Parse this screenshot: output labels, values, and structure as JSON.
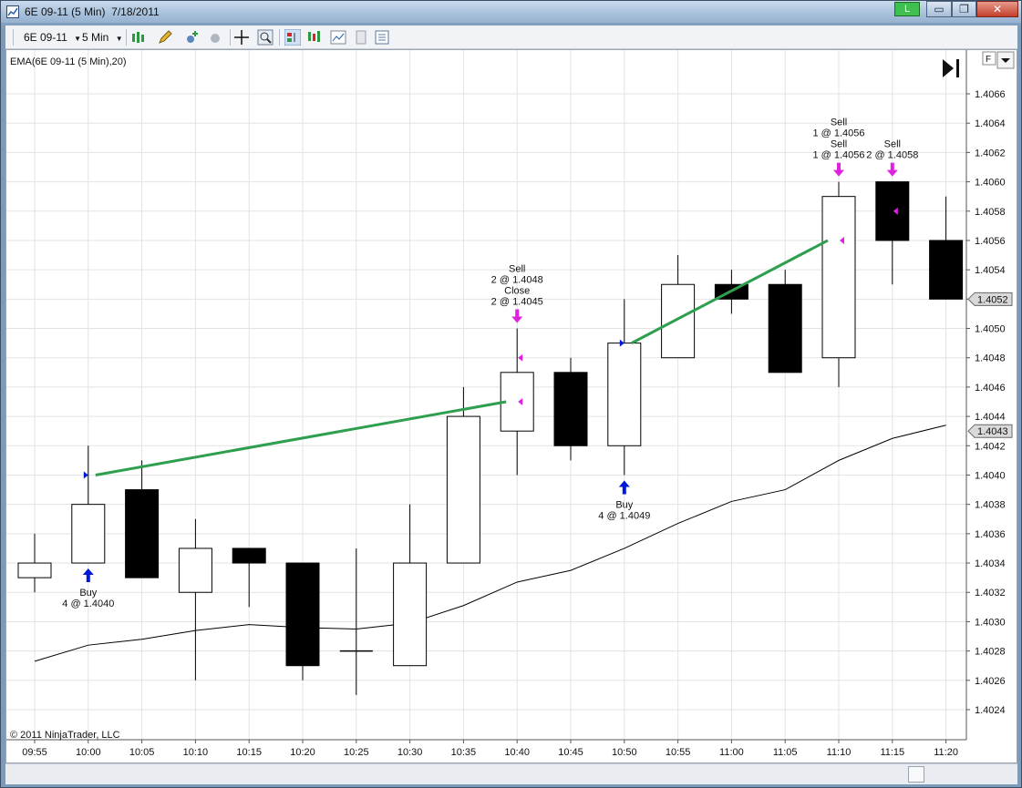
{
  "window": {
    "title": "6E 09-11 (5 Min)  7/18/2011",
    "badge": "L",
    "min_glyph": "▭",
    "restore_glyph": "❐",
    "close_glyph": "✕"
  },
  "toolbar": {
    "instrument": "6E 09-11",
    "period": "5 Min"
  },
  "chart": {
    "indicator_label": "EMA(6E 09-11 (5 Min),20)",
    "copyright": "© 2011 NinjaTrader, LLC",
    "f_button": "F",
    "price_marker_close": "1.4052",
    "price_marker_ema": "1.4043"
  },
  "colors": {
    "up_candle": "#ffffff",
    "down_candle": "#000000",
    "ema": "#000000",
    "trade_line": "#2e9e4f",
    "buy_arrow": "#0018d8",
    "sell_arrow": "#e020e0",
    "grid": "#e3e3e3"
  },
  "chart_data": {
    "type": "candlestick",
    "ylim": [
      1.4022,
      1.4068
    ],
    "y_ticks": [
      "1.4024",
      "1.4026",
      "1.4028",
      "1.4030",
      "1.4032",
      "1.4034",
      "1.4036",
      "1.4038",
      "1.4040",
      "1.4042",
      "1.4044",
      "1.4046",
      "1.4048",
      "1.4050",
      "1.4052",
      "1.4054",
      "1.4056",
      "1.4058",
      "1.4060",
      "1.4062",
      "1.4064",
      "1.4066"
    ],
    "categories": [
      "09:55",
      "10:00",
      "10:05",
      "10:10",
      "10:15",
      "10:20",
      "10:25",
      "10:30",
      "10:35",
      "10:40",
      "10:45",
      "10:50",
      "10:55",
      "11:00",
      "11:05",
      "11:10",
      "11:15",
      "11:20"
    ],
    "candles": [
      {
        "t": "09:55",
        "o": 1.4033,
        "h": 1.4036,
        "l": 1.4032,
        "c": 1.4034
      },
      {
        "t": "10:00",
        "o": 1.4034,
        "h": 1.4042,
        "l": 1.4034,
        "c": 1.4038
      },
      {
        "t": "10:05",
        "o": 1.4039,
        "h": 1.4041,
        "l": 1.4033,
        "c": 1.4033
      },
      {
        "t": "10:10",
        "o": 1.4032,
        "h": 1.4037,
        "l": 1.4026,
        "c": 1.4035
      },
      {
        "t": "10:15",
        "o": 1.4035,
        "h": 1.4035,
        "l": 1.4031,
        "c": 1.4034
      },
      {
        "t": "10:20",
        "o": 1.4034,
        "h": 1.4034,
        "l": 1.4026,
        "c": 1.4027
      },
      {
        "t": "10:25",
        "o": 1.4028,
        "h": 1.4035,
        "l": 1.4025,
        "c": 1.4028
      },
      {
        "t": "10:30",
        "o": 1.4027,
        "h": 1.4038,
        "l": 1.4027,
        "c": 1.4034
      },
      {
        "t": "10:35",
        "o": 1.4034,
        "h": 1.4046,
        "l": 1.4034,
        "c": 1.4044
      },
      {
        "t": "10:40",
        "o": 1.4043,
        "h": 1.405,
        "l": 1.404,
        "c": 1.4047
      },
      {
        "t": "10:45",
        "o": 1.4047,
        "h": 1.4048,
        "l": 1.4041,
        "c": 1.4042
      },
      {
        "t": "10:50",
        "o": 1.4042,
        "h": 1.4052,
        "l": 1.404,
        "c": 1.4049
      },
      {
        "t": "10:55",
        "o": 1.4048,
        "h": 1.4055,
        "l": 1.4048,
        "c": 1.4053
      },
      {
        "t": "11:00",
        "o": 1.4053,
        "h": 1.4054,
        "l": 1.4051,
        "c": 1.4052
      },
      {
        "t": "11:05",
        "o": 1.4053,
        "h": 1.4054,
        "l": 1.4047,
        "c": 1.4047
      },
      {
        "t": "11:10",
        "o": 1.4048,
        "h": 1.406,
        "l": 1.4046,
        "c": 1.4059
      },
      {
        "t": "11:15",
        "o": 1.406,
        "h": 1.406,
        "l": 1.4053,
        "c": 1.4056
      },
      {
        "t": "11:20",
        "o": 1.4056,
        "h": 1.4059,
        "l": 1.4052,
        "c": 1.4052
      }
    ],
    "series": [
      {
        "name": "EMA(6E 09-11 (5 Min),20)",
        "values": [
          1.40273,
          1.40284,
          1.40288,
          1.40294,
          1.40298,
          1.40296,
          1.40295,
          1.40299,
          1.40311,
          1.40327,
          1.40335,
          1.4035,
          1.40367,
          1.40382,
          1.4039,
          1.4041,
          1.40425,
          1.40434
        ]
      }
    ],
    "trade_lines": [
      {
        "from_t": "10:00",
        "from_price": 1.404,
        "to_t": "10:40",
        "to_price": 1.4045
      },
      {
        "from_t": "10:50",
        "from_price": 1.4049,
        "to_t": "11:10",
        "to_price": 1.4056
      }
    ],
    "execution_markers": [
      {
        "t": "10:00",
        "price": 1.404,
        "side": "buy"
      },
      {
        "t": "10:40",
        "price": 1.4048,
        "side": "sell"
      },
      {
        "t": "10:40",
        "price": 1.4045,
        "side": "sell"
      },
      {
        "t": "10:50",
        "price": 1.4049,
        "side": "buy"
      },
      {
        "t": "11:10",
        "price": 1.4056,
        "side": "sell"
      },
      {
        "t": "11:15",
        "price": 1.4058,
        "side": "sell"
      }
    ],
    "executions": [
      {
        "t": "10:00",
        "side": "buy",
        "anchor": "below",
        "lines": [
          "Buy",
          "4 @ 1.4040"
        ]
      },
      {
        "t": "10:40",
        "side": "sell",
        "anchor": "above",
        "lines": [
          "Sell",
          "2 @ 1.4048",
          "Close",
          "2 @ 1.4045"
        ]
      },
      {
        "t": "10:50",
        "side": "buy",
        "anchor": "below",
        "lines": [
          "Buy",
          "4 @ 1.4049"
        ]
      },
      {
        "t": "11:10",
        "side": "sell",
        "anchor": "above",
        "lines": [
          "Sell",
          "1 @ 1.4056",
          "Sell",
          "1 @ 1.4056"
        ]
      },
      {
        "t": "11:15",
        "side": "sell",
        "anchor": "above",
        "lines": [
          "Sell",
          "2 @ 1.4058"
        ]
      }
    ]
  }
}
